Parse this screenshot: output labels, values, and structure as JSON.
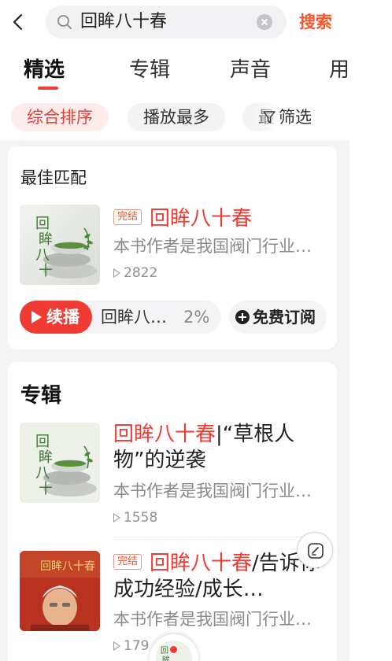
{
  "search": {
    "query": "回眸八十春",
    "action_label": "搜索"
  },
  "tabs": [
    {
      "label": "精选",
      "active": true
    },
    {
      "label": "专辑",
      "active": false
    },
    {
      "label": "声音",
      "active": false
    },
    {
      "label": "用",
      "active": false
    }
  ],
  "filters": {
    "chips": [
      "综合排序",
      "播放最多",
      "最"
    ],
    "filter_label": "筛选"
  },
  "best_match": {
    "section_title": "最佳匹配",
    "badge": "完结",
    "title": "回眸八十春",
    "description": "本书作者是我国阀门行业的开拓者",
    "plays": "2822",
    "cover_text": "回眸八十春",
    "continue": {
      "button_label": "续播",
      "track": "回眸八…",
      "progress": "2%"
    },
    "subscribe_label": "免费订阅"
  },
  "albums": {
    "section_title": "专辑",
    "items": [
      {
        "title_highlight": "回眸八十春",
        "title_rest": "|“草根人物”的逆袭",
        "description": "本书作者是我国阀门行业的开拓者",
        "plays": "1558",
        "cover_text": "回眸八十春"
      },
      {
        "badge": "完结",
        "title_highlight": "回眸八十春",
        "title_rest": "/告诉你成功经验/成长…",
        "description": "本书作者是我国阀门行业的开拓者",
        "plays": "179",
        "cover_text": "回眸八十春"
      }
    ]
  },
  "colors": {
    "accent_red": "#ef3d35",
    "search_orange": "#f5582f",
    "background_gray": "#f4f4f6"
  },
  "icons": [
    "back-arrow-icon",
    "search-icon",
    "clear-icon",
    "filter-funnel-icon",
    "play-icon",
    "plus-icon",
    "edit-note-icon"
  ]
}
